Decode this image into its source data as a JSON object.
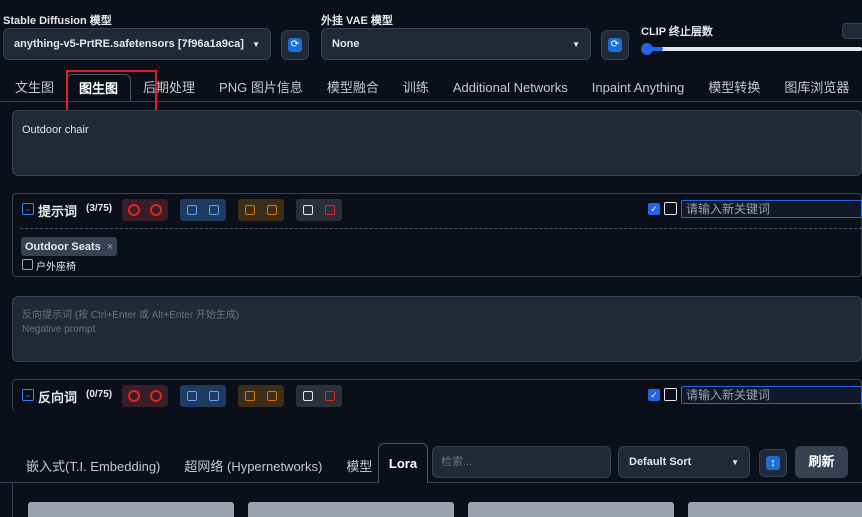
{
  "header": {
    "sd_model_label": "Stable Diffusion 模型",
    "sd_model_value": "anything-v5-PrtRE.safetensors [7f96a1a9ca]",
    "vae_label": "外挂 VAE 模型",
    "vae_value": "None",
    "clip_label": "CLIP 终止层数"
  },
  "tabs": [
    "文生图",
    "图生图",
    "后期处理",
    "PNG 图片信息",
    "模型融合",
    "训练",
    "Additional Networks",
    "Inpaint Anything",
    "模型转换",
    "图库浏览器"
  ],
  "active_tab": "图生图",
  "prompt": {
    "value": "Outdoor chair",
    "section_label": "提示词",
    "count": "(3/75)",
    "keyword_placeholder": "请输入新关键词",
    "tag_label": "Outdoor Seats",
    "tag_close": "×",
    "tag_translation": "户外座椅"
  },
  "negative": {
    "placeholder_line1": "反向提示词 (按 Ctrl+Enter 或 Alt+Enter 开始生成)",
    "placeholder_line2": "Negative prompt",
    "section_label": "反向词",
    "count": "(0/75)",
    "keyword_placeholder": "请输入新关键词"
  },
  "networks": {
    "tabs": [
      "嵌入式(T.I. Embedding)",
      "超网络 (Hypernetworks)",
      "模型",
      "Lora"
    ],
    "active_tab": "Lora",
    "search_placeholder": "检索...",
    "sort_value": "Default Sort",
    "refresh_label": "刷新"
  },
  "colors": {
    "accent": "#2563eb",
    "highlight_box": "#e11d2e",
    "red_icon": "#dc2626",
    "blue_icon": "#3b82f6",
    "orange_icon": "#d97706"
  }
}
